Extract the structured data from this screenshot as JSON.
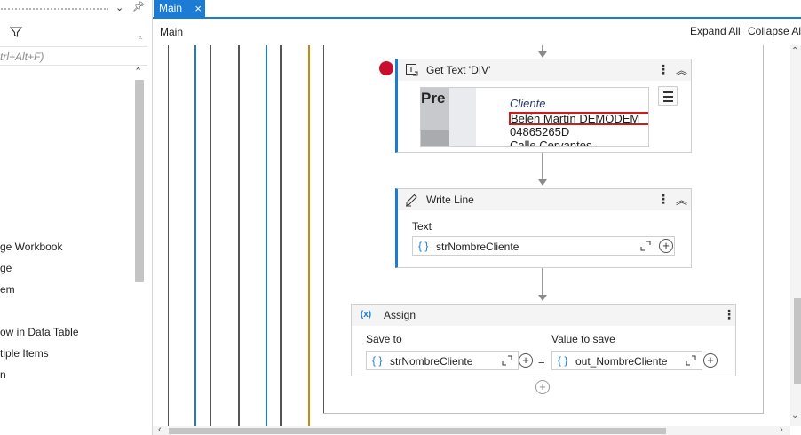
{
  "left_panel": {
    "search_placeholder": "trl+Alt+F)",
    "items": [
      "ge Workbook",
      "ge",
      "em",
      "",
      "ow in Data Table",
      "tiple Items",
      "n"
    ]
  },
  "tabs": [
    {
      "label": "Main",
      "close_icon": "×"
    }
  ],
  "header": {
    "breadcrumb": "Main",
    "expand_all": "Expand All",
    "collapse_all": "Collapse Al"
  },
  "activities": {
    "get_text": {
      "title": "Get Text 'DIV'",
      "icon": "get-text-icon",
      "has_breakpoint": true,
      "preview": {
        "pre": "Pre",
        "cliente": "Cliente",
        "name": "Belén Martín DEMODEM",
        "id": "04865265D",
        "address": "Calle Cervantes"
      }
    },
    "write_line": {
      "title": "Write Line",
      "icon": "write-line-icon",
      "text_label": "Text",
      "text_value": "strNombreCliente"
    },
    "assign": {
      "title": "Assign",
      "icon": "assign-icon",
      "save_to_label": "Save to",
      "save_to_value": "strNombreCliente",
      "value_label": "Value to save",
      "value_value": "out_NombreCliente",
      "equals": "="
    }
  },
  "colors": {
    "accent": "#1c7cd5",
    "breakpoint": "#c8102e",
    "selection_box": "#d11a1a",
    "guide_blue": "#1c7cd5",
    "guide_gray": "#555555",
    "guide_orange": "#c98a0a"
  }
}
